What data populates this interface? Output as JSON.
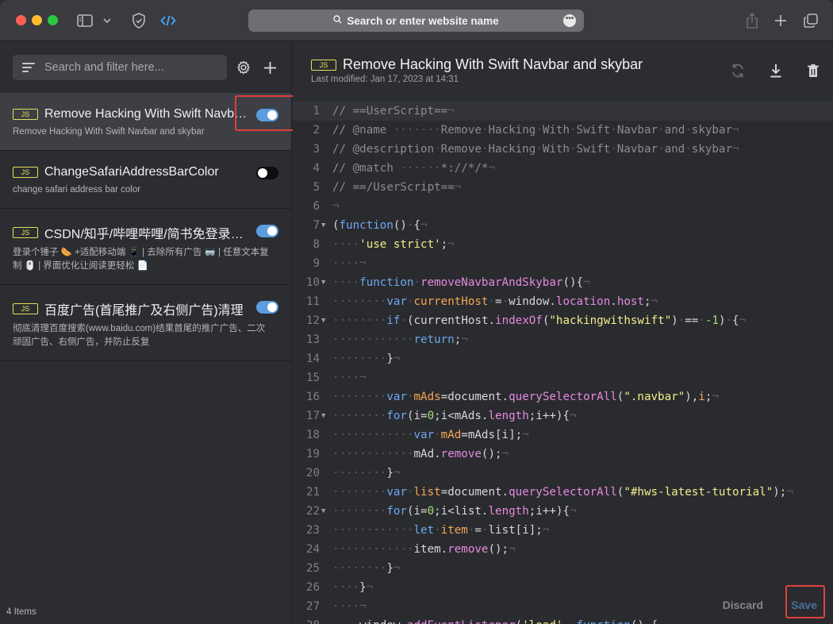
{
  "browser": {
    "url_placeholder": "Search or enter website name",
    "more_glyph": "•••"
  },
  "sidebar": {
    "search_placeholder": "Search and filter here...",
    "items_count": "4 Items",
    "items": [
      {
        "badge": "JS",
        "title": "Remove Hacking With Swift Navbar...",
        "description": "Remove Hacking With Swift Navbar and skybar",
        "enabled": true,
        "active": true
      },
      {
        "badge": "JS",
        "title": "ChangeSafariAddressBarColor",
        "description": "change safari address bar color",
        "enabled": false,
        "active": false
      },
      {
        "badge": "JS",
        "title": "CSDN/知乎/哔哩哔哩/简书免登录去...",
        "description": "登录个锤子 🌭 +适配移动端 📱 | 去除所有广告 🥽 | 任意文本复制 🖱️ | 界面优化让阅读更轻松 📄",
        "enabled": true,
        "active": false
      },
      {
        "badge": "JS",
        "title": "百度广告(首尾推广及右侧广告)清理",
        "description": "彻底清理百度搜索(www.baidu.com)结果首尾的推广广告、二次顽固广告、右侧广告，并防止反复",
        "enabled": true,
        "active": false
      }
    ]
  },
  "editor": {
    "badge": "JS",
    "title": "Remove Hacking With Swift Navbar and skybar",
    "last_modified": "Last modified: Jan 17, 2023 at 14:31",
    "discard_label": "Discard",
    "save_label": "Save",
    "code_lines": [
      {
        "n": "1",
        "fold": false,
        "html": "<span class='cm'>// ==UserScript==</span><span class='ws'>¬</span>"
      },
      {
        "n": "2",
        "fold": false,
        "html": "<span class='cm'>// @name</span><span class='ws'> ·······</span><span class='cm'>Remove</span><span class='ws'>·</span><span class='cm'>Hacking</span><span class='ws'>·</span><span class='cm'>With</span><span class='ws'>·</span><span class='cm'>Swift</span><span class='ws'>·</span><span class='cm'>Navbar</span><span class='ws'>·</span><span class='cm'>and</span><span class='ws'>·</span><span class='cm'>skybar</span><span class='ws'>¬</span>"
      },
      {
        "n": "3",
        "fold": false,
        "html": "<span class='cm'>// @description</span><span class='ws'>·</span><span class='cm'>Remove</span><span class='ws'>·</span><span class='cm'>Hacking</span><span class='ws'>·</span><span class='cm'>With</span><span class='ws'>·</span><span class='cm'>Swift</span><span class='ws'>·</span><span class='cm'>Navbar</span><span class='ws'>·</span><span class='cm'>and</span><span class='ws'>·</span><span class='cm'>skybar</span><span class='ws'>¬</span>"
      },
      {
        "n": "4",
        "fold": false,
        "html": "<span class='cm'>// @match</span><span class='ws'> ······</span><span class='cm'>*://*/*</span><span class='ws'>¬</span>"
      },
      {
        "n": "5",
        "fold": false,
        "html": "<span class='cm'>// ==/UserScript==</span><span class='ws'>¬</span>"
      },
      {
        "n": "6",
        "fold": false,
        "html": "<span class='ws'>¬</span>"
      },
      {
        "n": "7",
        "fold": true,
        "html": "<span class='pl'>(</span><span class='kw'>function</span><span class='pl'>()</span><span class='ws'>·</span><span class='pl'>{</span><span class='ws'>¬</span>"
      },
      {
        "n": "8",
        "fold": false,
        "html": "<span class='ws'>····</span><span class='str'>'use strict'</span><span class='pl'>;</span><span class='ws'>¬</span>"
      },
      {
        "n": "9",
        "fold": false,
        "html": "<span class='ws'>····¬</span>"
      },
      {
        "n": "10",
        "fold": true,
        "html": "<span class='ws'>····</span><span class='kw'>function</span><span class='ws'>·</span><span class='fn'>removeNavbarAndSkybar</span><span class='pl'>(){</span><span class='ws'>¬</span>"
      },
      {
        "n": "11",
        "fold": false,
        "html": "<span class='ws'>········</span><span class='kw'>var</span><span class='ws'>·</span><span class='vr'>currentHost</span><span class='ws'>·</span><span class='pl'>=</span><span class='ws'>·</span><span class='pl'>window.</span><span class='prop'>location</span><span class='pl'>.</span><span class='prop'>host</span><span class='pl'>;</span><span class='ws'>¬</span>"
      },
      {
        "n": "12",
        "fold": true,
        "html": "<span class='ws'>········</span><span class='kw'>if</span><span class='ws'>·</span><span class='pl'>(currentHost.</span><span class='fn'>indexOf</span><span class='pl'>(</span><span class='str'>\"hackingwithswift\"</span><span class='pl'>)</span><span class='ws'>·</span><span class='pl'>==</span><span class='ws'>·</span><span class='num'>-1</span><span class='pl'>)</span><span class='ws'>·</span><span class='pl'>{</span><span class='ws'>¬</span>"
      },
      {
        "n": "13",
        "fold": false,
        "html": "<span class='ws'>············</span><span class='kw'>return</span><span class='pl'>;</span><span class='ws'>¬</span>"
      },
      {
        "n": "14",
        "fold": false,
        "html": "<span class='ws'>········</span><span class='pl'>}</span><span class='ws'>¬</span>"
      },
      {
        "n": "15",
        "fold": false,
        "html": "<span class='ws'>····¬</span>"
      },
      {
        "n": "16",
        "fold": false,
        "html": "<span class='ws'>········</span><span class='kw'>var</span><span class='ws'>·</span><span class='vr'>mAds</span><span class='pl'>=document.</span><span class='fn'>querySelectorAll</span><span class='pl'>(</span><span class='str'>\".navbar\"</span><span class='pl'>),</span><span class='vr'>i</span><span class='pl'>;</span><span class='ws'>¬</span>"
      },
      {
        "n": "17",
        "fold": true,
        "html": "<span class='ws'>········</span><span class='kw'>for</span><span class='pl'>(i=</span><span class='num'>0</span><span class='pl'>;i&lt;mAds.</span><span class='prop'>length</span><span class='pl'>;i++){</span><span class='ws'>¬</span>"
      },
      {
        "n": "18",
        "fold": false,
        "html": "<span class='ws'>············</span><span class='kw'>var</span><span class='ws'>·</span><span class='vr'>mAd</span><span class='pl'>=mAds[i];</span><span class='ws'>¬</span>"
      },
      {
        "n": "19",
        "fold": false,
        "html": "<span class='ws'>············</span><span class='pl'>mAd.</span><span class='fn'>remove</span><span class='pl'>();</span><span class='ws'>¬</span>"
      },
      {
        "n": "20",
        "fold": false,
        "html": "<span class='ws'>········</span><span class='pl'>}</span><span class='ws'>¬</span>"
      },
      {
        "n": "21",
        "fold": false,
        "html": "<span class='ws'>········</span><span class='kw'>var</span><span class='ws'>·</span><span class='vr'>list</span><span class='pl'>=document.</span><span class='fn'>querySelectorAll</span><span class='pl'>(</span><span class='str'>\"#hws-latest-tutorial\"</span><span class='pl'>);</span><span class='ws'>¬</span>"
      },
      {
        "n": "22",
        "fold": true,
        "html": "<span class='ws'>········</span><span class='kw'>for</span><span class='pl'>(i=</span><span class='num'>0</span><span class='pl'>;i&lt;list.</span><span class='prop'>length</span><span class='pl'>;i++){</span><span class='ws'>¬</span>"
      },
      {
        "n": "23",
        "fold": false,
        "html": "<span class='ws'>············</span><span class='kw'>let</span><span class='ws'>·</span><span class='vr'>item</span><span class='ws'>·</span><span class='pl'>=</span><span class='ws'>·</span><span class='pl'>list[i];</span><span class='ws'>¬</span>"
      },
      {
        "n": "24",
        "fold": false,
        "html": "<span class='ws'>············</span><span class='pl'>item.</span><span class='fn'>remove</span><span class='pl'>();</span><span class='ws'>¬</span>"
      },
      {
        "n": "25",
        "fold": false,
        "html": "<span class='ws'>········</span><span class='pl'>}</span><span class='ws'>¬</span>"
      },
      {
        "n": "26",
        "fold": false,
        "html": "<span class='ws'>····</span><span class='pl'>}</span><span class='ws'>¬</span>"
      },
      {
        "n": "27",
        "fold": false,
        "html": "<span class='ws'>····¬</span>"
      },
      {
        "n": "28",
        "fold": false,
        "html": "<span class='ws'>····</span><span class='pl'>window.</span><span class='fn'>addEventListener</span><span class='pl'>(</span><span class='str'>'load'</span><span class='pl'>,</span><span class='ws'>·</span><span class='kw'>function</span><span class='pl'>()</span><span class='ws'>·</span><span class='pl'>{</span>"
      }
    ]
  },
  "colors": {
    "accent": "#5b9ddf",
    "highlight": "#e0403b",
    "js_badge": "#e3e05a"
  }
}
